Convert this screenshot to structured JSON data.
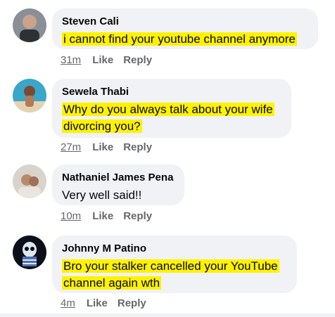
{
  "comments": [
    {
      "name": "Steven Cali",
      "lines": [
        "i cannot find your youtube channel anymore"
      ],
      "time": "31m",
      "like": "Like",
      "reply": "Reply"
    },
    {
      "name": "Sewela Thabi",
      "lines": [
        "Why do you always talk about your wife",
        "divorcing you?"
      ],
      "time": "27m",
      "like": "Like",
      "reply": "Reply"
    },
    {
      "name": "Nathaniel James Pena",
      "lines": [
        "Very well said!!"
      ],
      "time": "10m",
      "like": "Like",
      "reply": "Reply"
    },
    {
      "name": "Johnny M Patino",
      "lines": [
        "Bro your stalker cancelled your YouTube",
        "channel again wth"
      ],
      "time": "4m",
      "like": "Like",
      "reply": "Reply"
    }
  ],
  "colors": {
    "highlight": "#fff200",
    "bubble": "#f0f2f5",
    "meta": "#65676b"
  }
}
